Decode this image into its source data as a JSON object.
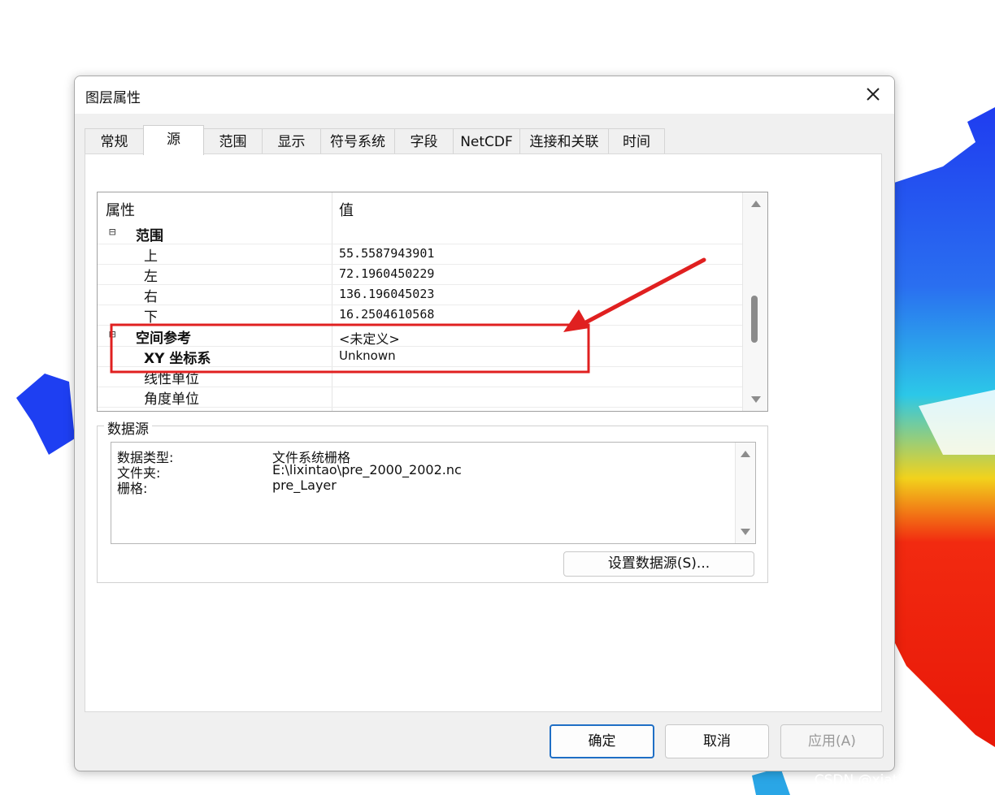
{
  "dialog": {
    "title": "图层属性",
    "tabs": [
      "常规",
      "源",
      "范围",
      "显示",
      "符号系统",
      "字段",
      "NetCDF",
      "连接和关联",
      "时间"
    ],
    "active_tab": "源"
  },
  "property_grid": {
    "col_property": "属性",
    "col_value": "值",
    "rows": [
      {
        "key": "范围",
        "value": "",
        "bold": true,
        "expander": "⊟"
      },
      {
        "key": "上",
        "value": "55.5587943901"
      },
      {
        "key": "左",
        "value": "72.1960450229"
      },
      {
        "key": "右",
        "value": "136.196045023"
      },
      {
        "key": "下",
        "value": "16.2504610568"
      },
      {
        "key": "空间参考",
        "value": "<未定义>",
        "bold": true,
        "expander": "⊟"
      },
      {
        "key": "XY 坐标系",
        "value": "Unknown",
        "bold": true
      },
      {
        "key": "线性单位",
        "value": ""
      },
      {
        "key": "角度单位",
        "value": ""
      }
    ]
  },
  "data_source": {
    "label": "数据源",
    "items": [
      {
        "key": "数据类型:",
        "value": "文件系统栅格"
      },
      {
        "key": "文件夹:",
        "value": "E:\\lixintao\\pre_2000_2002.nc"
      },
      {
        "key": "栅格:",
        "value": "pre_Layer"
      }
    ],
    "set_button": "设置数据源(S)..."
  },
  "buttons": {
    "ok": "确定",
    "cancel": "取消",
    "apply": "应用(A)"
  },
  "colors": {
    "annotation_red": "#e02020",
    "primary_border": "#1f6fc5"
  },
  "watermark": "CSDN @xiatiandexia123"
}
